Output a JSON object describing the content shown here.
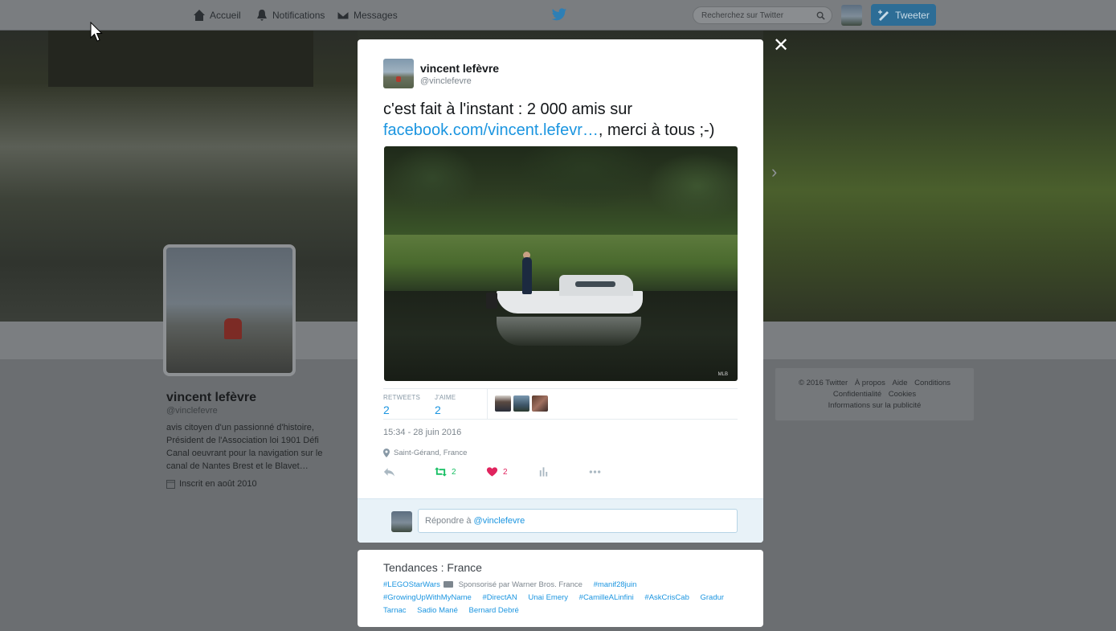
{
  "nav": {
    "home_label": "Accueil",
    "notifications_label": "Notifications",
    "messages_label": "Messages",
    "search_placeholder": "Recherchez sur Twitter",
    "tweet_button_label": "Tweeter",
    "brand_icon": "twitter-bird-icon"
  },
  "profile": {
    "name": "vincent lefèvre",
    "handle": "@vinclefevre",
    "bio": "avis citoyen d'un passionné d'histoire, Président de l'Association loi 1901 Défi Canal oeuvrant pour la navigation sur le canal de Nantes Brest et le Blavet…",
    "joined": "Inscrit en août 2010"
  },
  "footer": {
    "links_row1": [
      "© 2016 Twitter",
      "À propos",
      "Aide",
      "Conditions"
    ],
    "links_row2": [
      "Confidentialité",
      "Cookies"
    ],
    "links_row3": [
      "Informations sur la publicité"
    ]
  },
  "tweet": {
    "author_name": "vincent lefèvre",
    "author_handle": "@vinclefevre",
    "text_before": "c'est fait à l'instant : 2 000 amis sur",
    "link_text": "facebook.com/vincent.lefevr…",
    "text_after": ", merci à tous ;-)",
    "photo_watermark": "MLB",
    "stats": {
      "retweets_label": "RETWEETS",
      "retweets_count": "2",
      "likes_label": "J'AIME",
      "likes_count": "2"
    },
    "timestamp": "15:34 - 28 juin 2016",
    "location": "Saint-Gérand, France",
    "actions": {
      "retweet_count": "2",
      "like_count": "2"
    }
  },
  "reply": {
    "placeholder_prefix": "Répondre à ",
    "mention": "@vinclefevre"
  },
  "trends": {
    "title": "Tendances : France",
    "items": [
      {
        "text": "#LEGOStarWars",
        "promoted_icon": true
      },
      {
        "text": "Sponsorisé par Warner Bros. France",
        "promo": true
      },
      {
        "text": "#manif28juin"
      },
      {
        "text": "#GrowingUpWithMyName"
      },
      {
        "text": "#DirectAN"
      },
      {
        "text": "Unai Emery"
      },
      {
        "text": "#CamilleALinfini"
      },
      {
        "text": "#AskCrisCab"
      },
      {
        "text": "Gradur"
      },
      {
        "text": "Tarnac"
      },
      {
        "text": "Sadio Mané"
      },
      {
        "text": "Bernard Debré"
      }
    ]
  },
  "colors": {
    "link": "#1b95e0",
    "retweet_green": "#17bf63",
    "like_red": "#e0245e",
    "overlay": "#6b6e71"
  }
}
